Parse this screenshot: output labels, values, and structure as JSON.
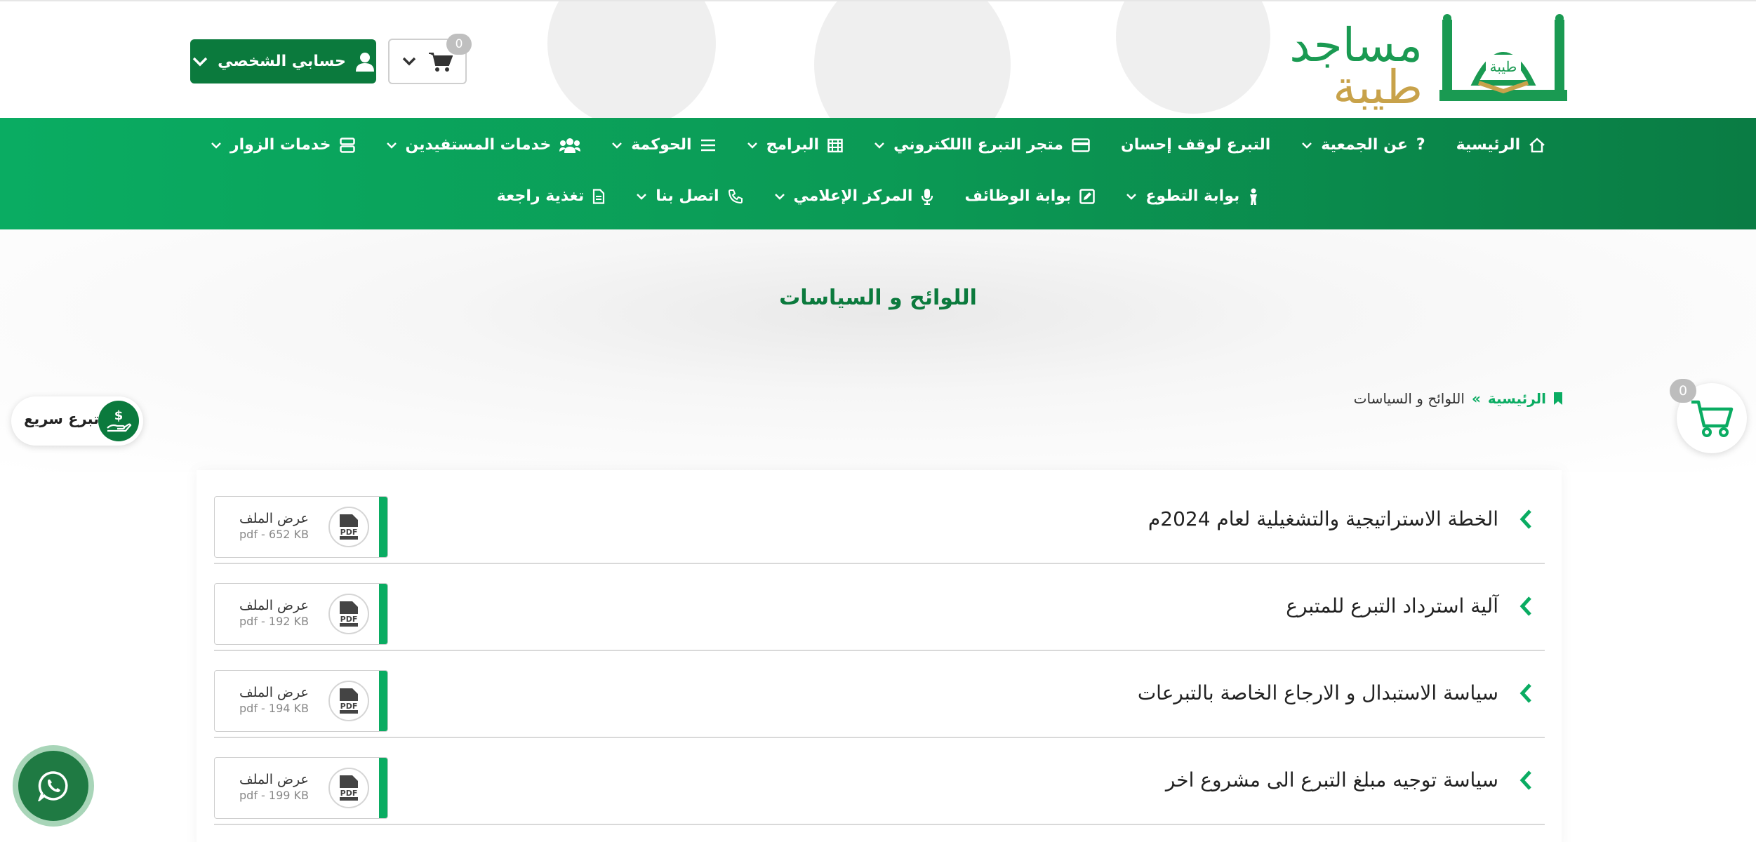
{
  "header": {
    "logo_line1": "مساجد",
    "logo_line2": "طيبة",
    "logo_emblem_text": "طيبة",
    "account_label": "حسابي الشخصي",
    "cart_count": "0"
  },
  "nav": {
    "row1": [
      {
        "label": "الرئيسية",
        "icon": "home-icon",
        "dropdown": false
      },
      {
        "label": "عن الجمعية",
        "icon": "question-icon",
        "dropdown": true
      },
      {
        "label": "التبرع لوقف إحسان",
        "icon": "",
        "dropdown": false
      },
      {
        "label": "متجر التبرع االلكتروني",
        "icon": "card-icon",
        "dropdown": true
      },
      {
        "label": "البرامج",
        "icon": "calendar-icon",
        "dropdown": true
      },
      {
        "label": "الحوكمة",
        "icon": "list-icon",
        "dropdown": true
      },
      {
        "label": "خدمات المستفيدين",
        "icon": "users-icon",
        "dropdown": true
      },
      {
        "label": "خدمات الزوار",
        "icon": "server-icon",
        "dropdown": true
      }
    ],
    "row2": [
      {
        "label": "بوابة التطوع",
        "icon": "person-icon",
        "dropdown": true
      },
      {
        "label": "بوابة الوظائف",
        "icon": "edit-icon",
        "dropdown": false
      },
      {
        "label": "المركز الإعلامي",
        "icon": "mic-icon",
        "dropdown": true
      },
      {
        "label": "اتصل بنا",
        "icon": "phone-icon",
        "dropdown": true
      },
      {
        "label": "تغذية راجعة",
        "icon": "file-icon",
        "dropdown": false
      }
    ]
  },
  "page": {
    "title": "اللوائح و السياسات",
    "breadcrumb_home": "الرئيسية",
    "breadcrumb_sep": "»",
    "breadcrumb_current": "اللوائح و السياسات"
  },
  "floating": {
    "cart_count": "0",
    "quick_donate_label": "تبرع سريع"
  },
  "documents": [
    {
      "title": "الخطة الاستراتيجية والتشغيلية لعام 2024م",
      "file_label": "عرض الملف",
      "file_meta": "pdf - 652 KB"
    },
    {
      "title": "آلية استرداد التبرع للمتبرع",
      "file_label": "عرض الملف",
      "file_meta": "pdf - 192 KB"
    },
    {
      "title": "سياسة الاستبدال و الارجاع الخاصة بالتبرعات",
      "file_label": "عرض الملف",
      "file_meta": "pdf - 194 KB"
    },
    {
      "title": "سياسة توجيه مبلغ التبرع الى مشروع اخر",
      "file_label": "عرض الملف",
      "file_meta": "pdf - 199 KB"
    }
  ],
  "colors": {
    "brand_green": "#0aac62",
    "dark_green": "#0b7a3d",
    "gold": "#c8a24a"
  }
}
